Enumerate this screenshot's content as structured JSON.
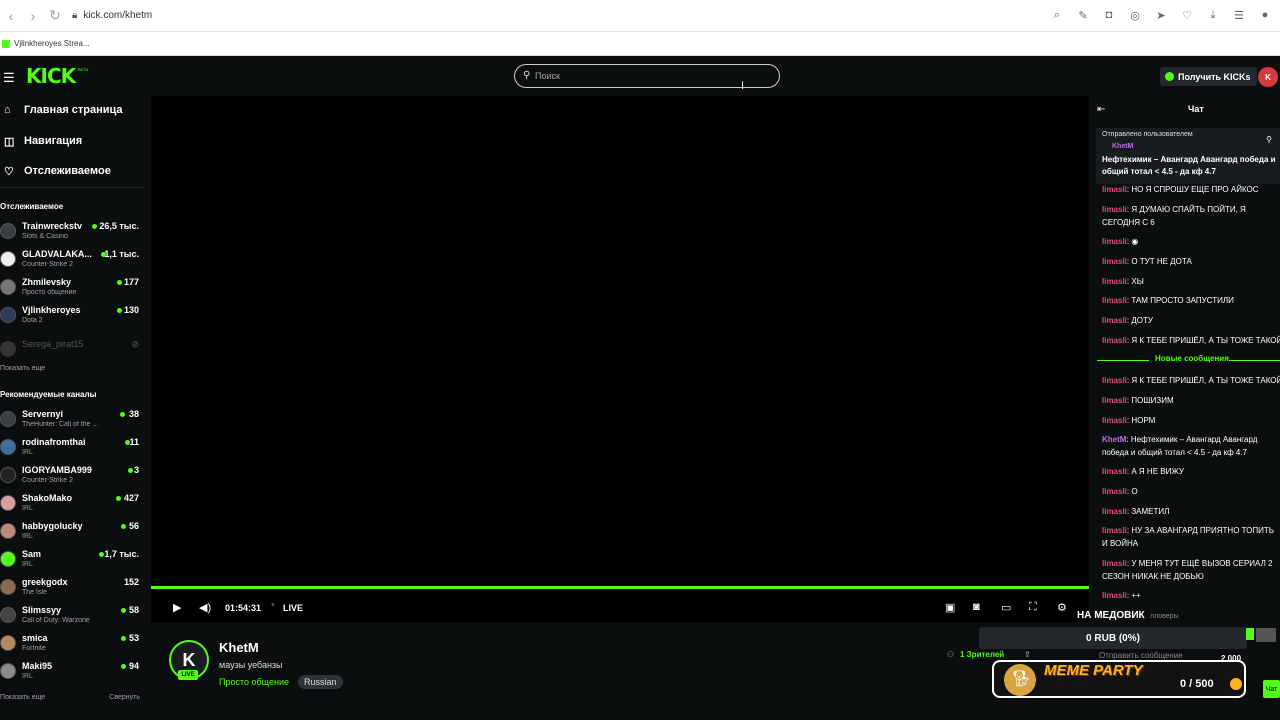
{
  "browser": {
    "url": "kick.com/khetm",
    "bookmark": "Vjlinkheroyes Strea..."
  },
  "header": {
    "search_placeholder": "Поиск",
    "get_kicks": "Получить KICKs",
    "logo": "KICK",
    "logo_beta": "BETA"
  },
  "sidebar": {
    "nav": [
      {
        "label": "Главная страница",
        "icon": "home-icon"
      },
      {
        "label": "Навигация",
        "icon": "compass-icon"
      },
      {
        "label": "Отслеживаемое",
        "icon": "heart-icon"
      }
    ],
    "followed_heading": "Отслеживаемое",
    "followed": [
      {
        "name": "Trainwreckstv",
        "sub": "Slots & Casino",
        "count": "26,5 тыс."
      },
      {
        "name": "GLADVALAKA...",
        "sub": "Counter-Strike 2",
        "count": "1,1 тыс."
      },
      {
        "name": "Zhmilevsky",
        "sub": "Просто общение",
        "count": "177"
      },
      {
        "name": "Vjlinkheroyes",
        "sub": "Dota 2",
        "count": "130"
      },
      {
        "name": "Serega_pirat15",
        "sub": "",
        "count": ""
      }
    ],
    "show_more": "Показать еще",
    "recommended_heading": "Рекомендуемые каналы",
    "recommended": [
      {
        "name": "Servernyi",
        "sub": "TheHunter: Call of the ...",
        "count": "38"
      },
      {
        "name": "rodinafromthai",
        "sub": "IRL",
        "count": "11"
      },
      {
        "name": "IGORYAMBA999",
        "sub": "Counter-Strike 2",
        "count": "3"
      },
      {
        "name": "ShakoMako",
        "sub": "IRL",
        "count": "427"
      },
      {
        "name": "habbygolucky",
        "sub": "IRL",
        "count": "56"
      },
      {
        "name": "Sam",
        "sub": "IRL",
        "count": "1,7 тыс."
      },
      {
        "name": "greekgodx",
        "sub": "The Isle",
        "count": "152"
      },
      {
        "name": "Slimssyy",
        "sub": "Call of Duty: Warzone",
        "count": "58"
      },
      {
        "name": "smica",
        "sub": "Fortnite",
        "count": "53"
      },
      {
        "name": "Maki95",
        "sub": "IRL",
        "count": "94"
      }
    ],
    "show_more_2": "Показать еще",
    "collapse": "Свернуть"
  },
  "player": {
    "time": "01:54:31",
    "live": "LIVE"
  },
  "stream": {
    "name": "KhetM",
    "title": "маузы уебанзы",
    "category": "Просто общение",
    "language": "Russian",
    "live_badge": "LIVE",
    "viewers": "1 Зрителей"
  },
  "chat": {
    "title": "Чат",
    "pinned_label": "Отправлено пользователем",
    "pinned_user": "KhetM",
    "pinned_text": "Нефтехимик – Авангард Авангард победа и общий тотал < 4.5 - да кф 4.7",
    "new_messages": "Новые сообщения",
    "messages": [
      {
        "user": "limasli",
        "text": ": НО Я СПРОШУ ЕЩЕ ПРО АЙКОС"
      },
      {
        "user": "limasli",
        "text": ": Я ДУМАЮ СПАЙТЬ ПОЙТИ, Я СЕГОДНЯ С 6"
      },
      {
        "user": "limasli",
        "text": ":"
      },
      {
        "user": "limasli",
        "text": ": О ТУТ НЕ ДОТА"
      },
      {
        "user": "limasli",
        "text": ": ХЫ"
      },
      {
        "user": "limasli",
        "text": ": ТАМ ПРОСТО ЗАПУСТИЛИ"
      },
      {
        "user": "limasli",
        "text": ": ДОТУ"
      },
      {
        "user": "limasli",
        "text": ": Я К ТЕБЕ ПРИШЁЛ, А ТЫ ТОЖЕ ТАКОЙ"
      },
      {
        "user": "limasli",
        "text": ": Я К ТЕБЕ ПРИШЁЛ, А ТЫ ТОЖЕ ТАКОЙ"
      },
      {
        "user": "limasli",
        "text": ": ПОШИЗИМ"
      },
      {
        "user": "limasli",
        "text": ": НОРМ"
      },
      {
        "user": "KhetM",
        "text": ": Нефтехимик – Авангард Авангард победа и общий тотал < 4.5 - да кф 4.7"
      },
      {
        "user": "limasli",
        "text": ": А Я НЕ ВИЖУ"
      },
      {
        "user": "limasli",
        "text": ": О"
      },
      {
        "user": "limasli",
        "text": ": ЗАМЕТИЛ"
      },
      {
        "user": "limasli",
        "text": ": НУ ЗА АВАНГАРД ПРИЯТНО ТОПИТЬ И ВОЙНА"
      },
      {
        "user": "limasli",
        "text": ": У МЕНЯ ТУТ ЕЩЁ ВЫЗОВ СЕРИАЛ 2 СЕЗОН НИКАК НЕ ДОБЬЮ"
      },
      {
        "user": "limasli",
        "text": ": ++"
      }
    ],
    "input_placeholder": "Отправить сообщение",
    "kicks_amount": "2 000",
    "chat_button": "Чат"
  },
  "overlay": {
    "goal_title": "НА МЕДОВИК",
    "followers": "лловеры",
    "rub": "0 RUB (0%)",
    "meme_party": "MEME PARTY",
    "meme_progress": "0 / 500"
  },
  "colors": {
    "accent": "#53fc18",
    "chat_user": "#e8497c",
    "streamer": "#c36bf5"
  }
}
